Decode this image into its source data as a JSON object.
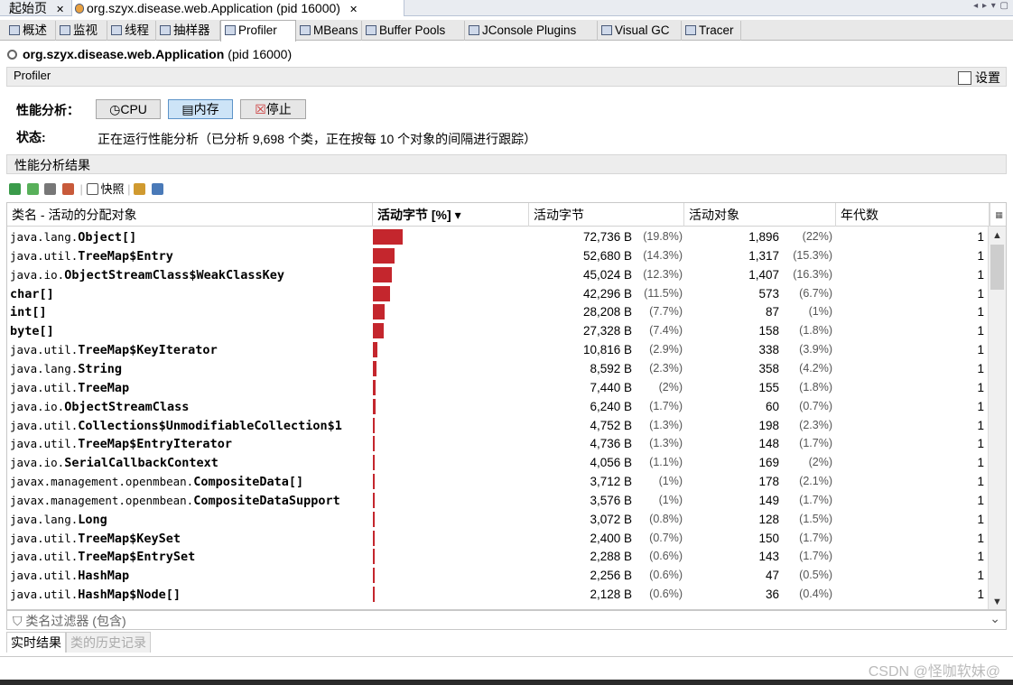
{
  "doc_tabs": [
    {
      "label": "起始页"
    },
    {
      "label": "org.szyx.disease.web.Application (pid 16000)"
    }
  ],
  "sub_tabs": [
    {
      "label": "概述",
      "icon": "overview-icon"
    },
    {
      "label": "监视",
      "icon": "monitor-icon"
    },
    {
      "label": "线程",
      "icon": "threads-icon"
    },
    {
      "label": "抽样器",
      "icon": "sampler-icon"
    },
    {
      "label": "Profiler",
      "icon": "profiler-icon"
    },
    {
      "label": "MBeans",
      "icon": "mbeans-icon"
    },
    {
      "label": "Buffer Pools",
      "icon": "buffer-pools-icon"
    },
    {
      "label": "JConsole Plugins",
      "icon": "jconsole-icon"
    },
    {
      "label": "Visual GC",
      "icon": "visual-gc-icon"
    },
    {
      "label": "Tracer",
      "icon": "tracer-icon"
    }
  ],
  "app": {
    "name": "org.szyx.disease.web.Application",
    "pid": "(pid 16000)"
  },
  "profiler_header": {
    "title": "Profiler",
    "settings_label": "设置"
  },
  "controls": {
    "label": "性能分析：",
    "cpu": "CPU",
    "memory": "内存",
    "stop": "停止"
  },
  "status": {
    "label": "状态:",
    "text": "正在运行性能分析（已分析 9,698 个类，正在按每 10 个对象的间隔进行跟踪）"
  },
  "results": {
    "title": "性能分析结果",
    "snapshot_label": "快照",
    "columns": [
      "类名 - 活动的分配对象",
      "活动字节 [%]",
      "活动字节",
      "活动对象",
      "年代数"
    ],
    "sort_indicator": "▾",
    "rows": [
      {
        "pkg": "java.lang.",
        "cls": "Object[]",
        "bytes": "72,736 B",
        "bytes_pct": "(19.8%)",
        "pct": 19.8,
        "objs": "1,896",
        "objs_pct": "(22%)",
        "gen": "1"
      },
      {
        "pkg": "java.util.",
        "cls": "TreeMap$Entry",
        "bytes": "52,680 B",
        "bytes_pct": "(14.3%)",
        "pct": 14.3,
        "objs": "1,317",
        "objs_pct": "(15.3%)",
        "gen": "1"
      },
      {
        "pkg": "java.io.",
        "cls": "ObjectStreamClass$WeakClassKey",
        "bytes": "45,024 B",
        "bytes_pct": "(12.3%)",
        "pct": 12.3,
        "objs": "1,407",
        "objs_pct": "(16.3%)",
        "gen": "1"
      },
      {
        "pkg": "",
        "cls": "char[]",
        "bytes": "42,296 B",
        "bytes_pct": "(11.5%)",
        "pct": 11.5,
        "objs": "573",
        "objs_pct": "(6.7%)",
        "gen": "1"
      },
      {
        "pkg": "",
        "cls": "int[]",
        "bytes": "28,208 B",
        "bytes_pct": "(7.7%)",
        "pct": 7.7,
        "objs": "87",
        "objs_pct": "(1%)",
        "gen": "1"
      },
      {
        "pkg": "",
        "cls": "byte[]",
        "bytes": "27,328 B",
        "bytes_pct": "(7.4%)",
        "pct": 7.4,
        "objs": "158",
        "objs_pct": "(1.8%)",
        "gen": "1"
      },
      {
        "pkg": "java.util.",
        "cls": "TreeMap$KeyIterator",
        "bytes": "10,816 B",
        "bytes_pct": "(2.9%)",
        "pct": 2.9,
        "objs": "338",
        "objs_pct": "(3.9%)",
        "gen": "1"
      },
      {
        "pkg": "java.lang.",
        "cls": "String",
        "bytes": "8,592 B",
        "bytes_pct": "(2.3%)",
        "pct": 2.3,
        "objs": "358",
        "objs_pct": "(4.2%)",
        "gen": "1"
      },
      {
        "pkg": "java.util.",
        "cls": "TreeMap",
        "bytes": "7,440 B",
        "bytes_pct": "(2%)",
        "pct": 2.0,
        "objs": "155",
        "objs_pct": "(1.8%)",
        "gen": "1"
      },
      {
        "pkg": "java.io.",
        "cls": "ObjectStreamClass",
        "bytes": "6,240 B",
        "bytes_pct": "(1.7%)",
        "pct": 1.7,
        "objs": "60",
        "objs_pct": "(0.7%)",
        "gen": "1"
      },
      {
        "pkg": "java.util.",
        "cls": "Collections$UnmodifiableCollection$1",
        "bytes": "4,752 B",
        "bytes_pct": "(1.3%)",
        "pct": 1.3,
        "objs": "198",
        "objs_pct": "(2.3%)",
        "gen": "1"
      },
      {
        "pkg": "java.util.",
        "cls": "TreeMap$EntryIterator",
        "bytes": "4,736 B",
        "bytes_pct": "(1.3%)",
        "pct": 1.3,
        "objs": "148",
        "objs_pct": "(1.7%)",
        "gen": "1"
      },
      {
        "pkg": "java.io.",
        "cls": "SerialCallbackContext",
        "bytes": "4,056 B",
        "bytes_pct": "(1.1%)",
        "pct": 1.1,
        "objs": "169",
        "objs_pct": "(2%)",
        "gen": "1"
      },
      {
        "pkg": "javax.management.openmbean.",
        "cls": "CompositeData[]",
        "bytes": "3,712 B",
        "bytes_pct": "(1%)",
        "pct": 1.0,
        "objs": "178",
        "objs_pct": "(2.1%)",
        "gen": "1"
      },
      {
        "pkg": "javax.management.openmbean.",
        "cls": "CompositeDataSupport",
        "bytes": "3,576 B",
        "bytes_pct": "(1%)",
        "pct": 1.0,
        "objs": "149",
        "objs_pct": "(1.7%)",
        "gen": "1"
      },
      {
        "pkg": "java.lang.",
        "cls": "Long",
        "bytes": "3,072 B",
        "bytes_pct": "(0.8%)",
        "pct": 0.8,
        "objs": "128",
        "objs_pct": "(1.5%)",
        "gen": "1"
      },
      {
        "pkg": "java.util.",
        "cls": "TreeMap$KeySet",
        "bytes": "2,400 B",
        "bytes_pct": "(0.7%)",
        "pct": 0.7,
        "objs": "150",
        "objs_pct": "(1.7%)",
        "gen": "1"
      },
      {
        "pkg": "java.util.",
        "cls": "TreeMap$EntrySet",
        "bytes": "2,288 B",
        "bytes_pct": "(0.6%)",
        "pct": 0.6,
        "objs": "143",
        "objs_pct": "(1.7%)",
        "gen": "1"
      },
      {
        "pkg": "java.util.",
        "cls": "HashMap",
        "bytes": "2,256 B",
        "bytes_pct": "(0.6%)",
        "pct": 0.6,
        "objs": "47",
        "objs_pct": "(0.5%)",
        "gen": "1"
      },
      {
        "pkg": "java.util.",
        "cls": "HashMap$Node[]",
        "bytes": "2,128 B",
        "bytes_pct": "(0.6%)",
        "pct": 0.6,
        "objs": "36",
        "objs_pct": "(0.4%)",
        "gen": "1"
      }
    ]
  },
  "filter": {
    "placeholder": "类名过滤器 (包含)"
  },
  "bottom_tabs": {
    "live": "实时结果",
    "history": "类的历史记录"
  },
  "watermark": "CSDN @怪咖软妹@",
  "colors": {
    "bar": "#c4262d",
    "active_button": "#cde4f7"
  }
}
